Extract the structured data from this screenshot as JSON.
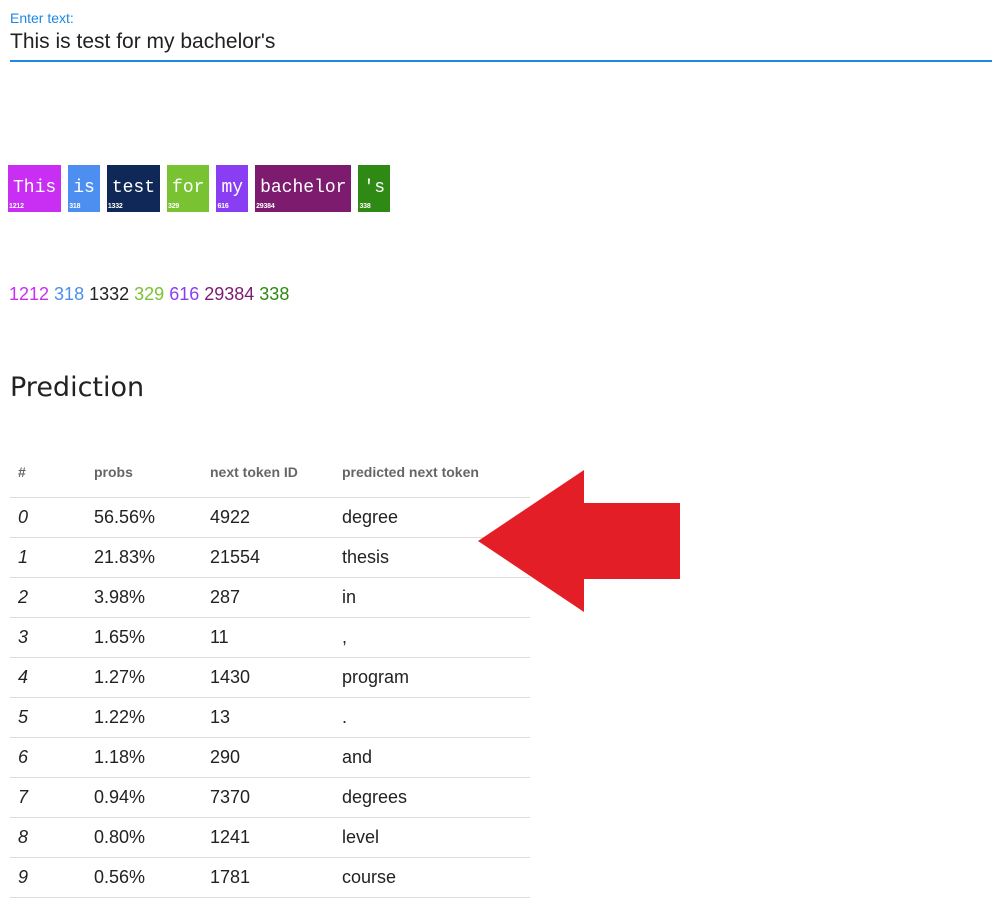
{
  "input": {
    "label": "Enter text:",
    "value": "This is test for my bachelor's"
  },
  "tokens": [
    {
      "text": "This",
      "id": "1212",
      "color": "#c82ff3"
    },
    {
      "text": "is",
      "id": "318",
      "color": "#4c8ff0"
    },
    {
      "text": "test",
      "id": "1332",
      "color": "#0f2857"
    },
    {
      "text": "for",
      "id": "329",
      "color": "#79c332"
    },
    {
      "text": "my",
      "id": "616",
      "color": "#8a3ef3"
    },
    {
      "text": "bachelor",
      "id": "29384",
      "color": "#7d1b6f"
    },
    {
      "text": "'s",
      "id": "338",
      "color": "#2e8a14"
    }
  ],
  "prediction": {
    "title": "Prediction",
    "columns": [
      "#",
      "probs",
      "next token ID",
      "predicted next token"
    ],
    "rows": [
      [
        "0",
        "56.56%",
        "4922",
        "degree"
      ],
      [
        "1",
        "21.83%",
        "21554",
        "thesis"
      ],
      [
        "2",
        "3.98%",
        "287",
        "in"
      ],
      [
        "3",
        "1.65%",
        "11",
        ","
      ],
      [
        "4",
        "1.27%",
        "1430",
        "program"
      ],
      [
        "5",
        "1.22%",
        "13",
        "."
      ],
      [
        "6",
        "1.18%",
        "290",
        "and"
      ],
      [
        "7",
        "0.94%",
        "7370",
        "degrees"
      ],
      [
        "8",
        "0.80%",
        "1241",
        "level"
      ],
      [
        "9",
        "0.56%",
        "1781",
        "course"
      ]
    ]
  },
  "annotation": {
    "arrow_color": "#e41e26",
    "arrow_icon": "left-arrow-icon"
  }
}
